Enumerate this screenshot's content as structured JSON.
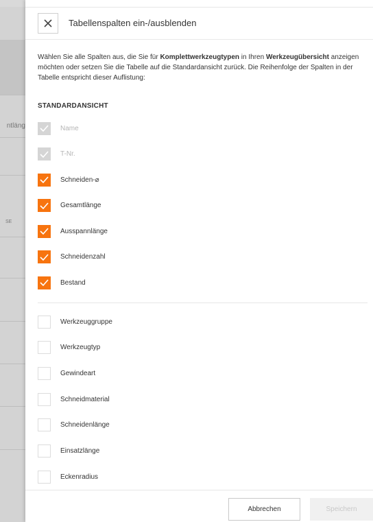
{
  "background": {
    "fragments": [
      "ntläng",
      "SE"
    ]
  },
  "dialog": {
    "title": "Tabellenspalten ein-/ausblenden",
    "description": {
      "part1": "Wählen Sie alle Spalten aus, die Sie für ",
      "bold1": "Komplettwerkzeugtypen",
      "part2": " in Ihren ",
      "bold2": "Werkzeugübersicht",
      "part3": " anzeigen möchten oder setzen Sie die Tabelle auf die Standardansicht zurück. Die Reihenfolge der Spalten in der Tabelle entspricht dieser Auflistung:"
    },
    "section_title": "STANDARDANSICHT",
    "default_columns": [
      {
        "label": "Name",
        "state": "disabled"
      },
      {
        "label": "T-Nr.",
        "state": "disabled"
      },
      {
        "label": "Schneiden-⌀",
        "state": "checked"
      },
      {
        "label": "Gesamtlänge",
        "state": "checked"
      },
      {
        "label": "Ausspannlänge",
        "state": "checked"
      },
      {
        "label": "Schneidenzahl",
        "state": "checked"
      },
      {
        "label": "Bestand",
        "state": "checked"
      }
    ],
    "other_columns": [
      {
        "label": "Werkzeuggruppe",
        "state": "unchecked"
      },
      {
        "label": "Werkzeugtyp",
        "state": "unchecked"
      },
      {
        "label": "Gewindeart",
        "state": "unchecked"
      },
      {
        "label": "Schneidmaterial",
        "state": "unchecked"
      },
      {
        "label": "Schneidenlänge",
        "state": "unchecked"
      },
      {
        "label": "Einsatzlänge",
        "state": "unchecked"
      },
      {
        "label": "Eckenradius",
        "state": "unchecked"
      }
    ],
    "cancel_label": "Abbrechen",
    "save_label": "Speichern"
  },
  "colors": {
    "accent": "#f7740f",
    "disabled_check": "#d5d5d5"
  }
}
